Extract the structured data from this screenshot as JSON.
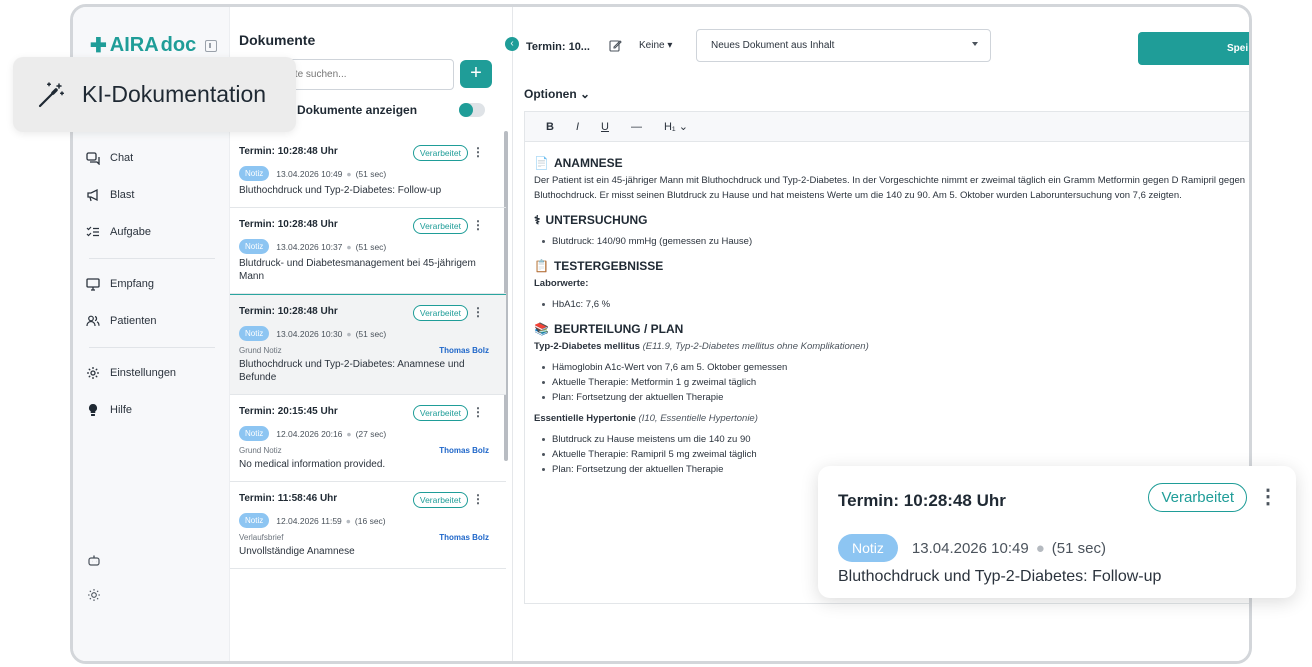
{
  "sidebar": {
    "logo": {
      "brand": "AIRA",
      "suffix": "doc"
    },
    "items": [
      {
        "label": "Chat",
        "icon": "chat-icon"
      },
      {
        "label": "Blast",
        "icon": "megaphone-icon"
      },
      {
        "label": "Aufgabe",
        "icon": "checklist-icon"
      },
      {
        "label": "Empfang",
        "icon": "monitor-icon"
      },
      {
        "label": "Patienten",
        "icon": "users-icon"
      },
      {
        "label": "Einstellungen",
        "icon": "gear-icon"
      },
      {
        "label": "Hilfe",
        "icon": "lightbulb-icon"
      }
    ]
  },
  "doclist": {
    "title": "Dokumente",
    "search_placeholder": "Dokumente suchen...",
    "add_label": "+",
    "show_all_label": "Dokumente anzeigen",
    "cards": [
      {
        "title": "Termin: 10:28:48 Uhr",
        "status": "Verarbeitet",
        "tag": "Notiz",
        "date": "13.04.2026 10:49",
        "duration": "(51 sec)",
        "reason_label": "",
        "author": "",
        "summary": "Bluthochdruck und Typ-2-Diabetes: Follow-up"
      },
      {
        "title": "Termin: 10:28:48 Uhr",
        "status": "Verarbeitet",
        "tag": "Notiz",
        "date": "13.04.2026 10:37",
        "duration": "(51 sec)",
        "reason_label": "",
        "author": "",
        "summary": "Blutdruck- und Diabetesmanagement bei 45-jährigem Mann"
      },
      {
        "title": "Termin: 10:28:48 Uhr",
        "status": "Verarbeitet",
        "tag": "Notiz",
        "date": "13.04.2026 10:30",
        "duration": "(51 sec)",
        "reason_label": "Grund Notiz",
        "author": "Thomas Bolz",
        "summary": "Bluthochdruck und Typ-2-Diabetes: Anamnese und Befunde"
      },
      {
        "title": "Termin: 20:15:45 Uhr",
        "status": "Verarbeitet",
        "tag": "Notiz",
        "date": "12.04.2026 20:16",
        "duration": "(27 sec)",
        "reason_label": "Grund Notiz",
        "author": "Thomas Bolz",
        "summary": "No medical information provided."
      },
      {
        "title": "Termin: 11:58:46 Uhr",
        "status": "Verarbeitet",
        "tag": "Notiz",
        "date": "12.04.2026 11:59",
        "duration": "(16 sec)",
        "reason_label": "Verlaufsbrief",
        "author": "Thomas Bolz",
        "summary": "Unvollständige Anamnese"
      }
    ]
  },
  "main": {
    "title": "Termin: 10...",
    "template_label": "Keine",
    "select_value": "Neues Dokument aus Inhalt",
    "save_label": "Spei",
    "options_label": "Optionen",
    "toolbar": {
      "bold": "B",
      "italic": "I",
      "underline": "U",
      "divider": "—",
      "heading": "H₁"
    },
    "content": {
      "anamnese_title": "ANAMNESE",
      "anamnese_text": "Der Patient ist ein 45-jähriger Mann mit Bluthochdruck und Typ-2-Diabetes. In der Vorgeschichte nimmt er zweimal täglich ein Gramm Metformin gegen D Ramipril gegen Bluthochdruck. Er misst seinen Blutdruck zu Hause und hat meistens Werte um die 140 zu 90. Am 5. Oktober wurden Laboruntersuchung von 7,6 zeigten.",
      "untersuchung_title": "UNTERSUCHUNG",
      "untersuchung_items": [
        "Blutdruck: 140/90 mmHg (gemessen zu Hause)"
      ],
      "test_title": "TESTERGEBNISSE",
      "labor_label": "Laborwerte:",
      "labor_items": [
        "HbA1c: 7,6 %"
      ],
      "plan_title": "BEURTEILUNG / PLAN",
      "dx1_label": "Typ-2-Diabetes mellitus",
      "dx1_code": "(E11.9, Typ-2-Diabetes mellitus ohne Komplikationen)",
      "dx1_items": [
        "Hämoglobin A1c-Wert von 7,6 am 5. Oktober gemessen",
        "Aktuelle Therapie: Metformin 1 g zweimal täglich",
        "Plan: Fortsetzung der aktuellen Therapie"
      ],
      "dx2_label": "Essentielle Hypertonie",
      "dx2_code": "(I10, Essentielle Hypertonie)",
      "dx2_items": [
        "Blutdruck zu Hause meistens um die 140 zu 90",
        "Aktuelle Therapie: Ramipril 5 mg zweimal täglich",
        "Plan: Fortsetzung der aktuellen Therapie"
      ]
    }
  },
  "overlay_pill": {
    "label": "KI-Dokumentation",
    "icon": "magic-wand-icon"
  },
  "overlay_card": {
    "title": "Termin: 10:28:48 Uhr",
    "status": "Verarbeitet",
    "tag": "Notiz",
    "date": "13.04.2026 10:49",
    "duration": "(51 sec)",
    "summary": "Bluthochdruck und Typ-2-Diabetes: Follow-up"
  },
  "colors": {
    "accent": "#1f9d98",
    "tag": "#8dc5f2",
    "author": "#1e66c9"
  }
}
